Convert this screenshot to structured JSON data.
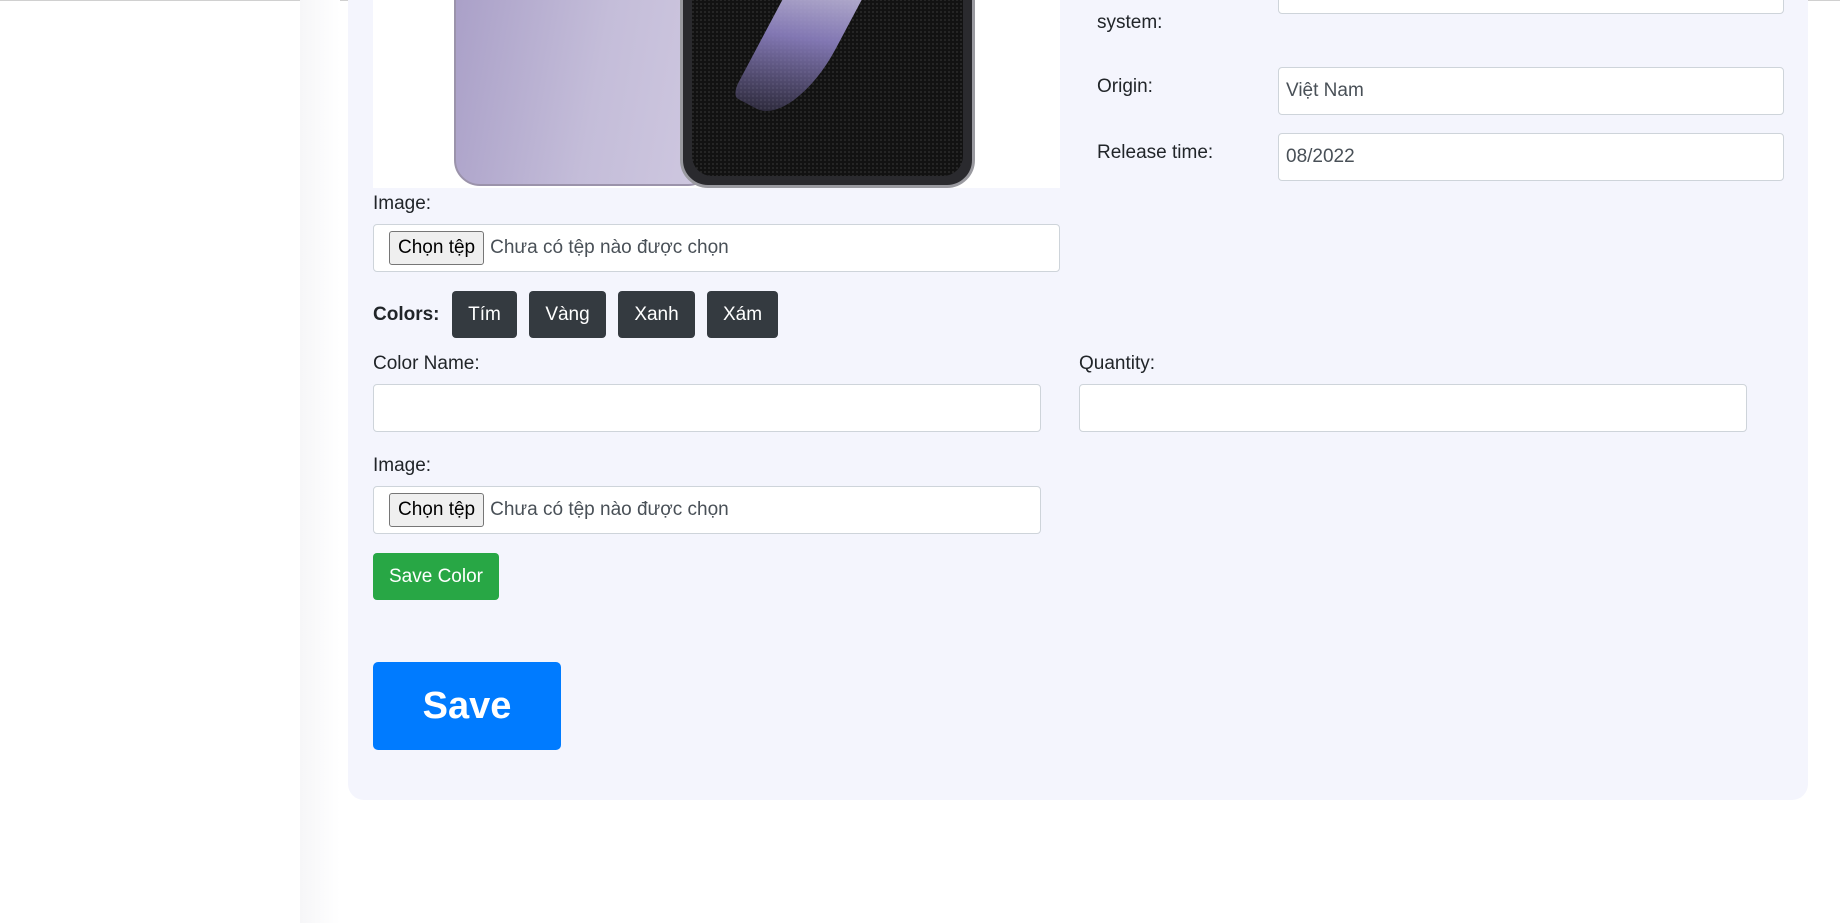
{
  "product_form": {
    "os_label_tail": "system:",
    "origin_label": "Origin:",
    "origin_value": "Việt Nam",
    "release_label": "Release time:",
    "release_value": "08/2022",
    "image_label": "Image:",
    "file_button_label": "Chọn tệp",
    "file_status": "Chưa có tệp nào được chọn",
    "colors_label": "Colors:",
    "colors": [
      "Tím",
      "Vàng",
      "Xanh",
      "Xám"
    ]
  },
  "color_form": {
    "color_name_label": "Color Name:",
    "color_name_value": "",
    "quantity_label": "Quantity:",
    "quantity_value": "",
    "image_label": "Image:",
    "file_button_label": "Chọn tệp",
    "file_status": "Chưa có tệp nào được chọn",
    "save_color_label": "Save Color"
  },
  "save_label": "Save",
  "colors": {
    "card_bg": "#f4f5fd",
    "chip_bg": "#343a40",
    "save_color_bg": "#28a745",
    "save_bg": "#007bff"
  }
}
